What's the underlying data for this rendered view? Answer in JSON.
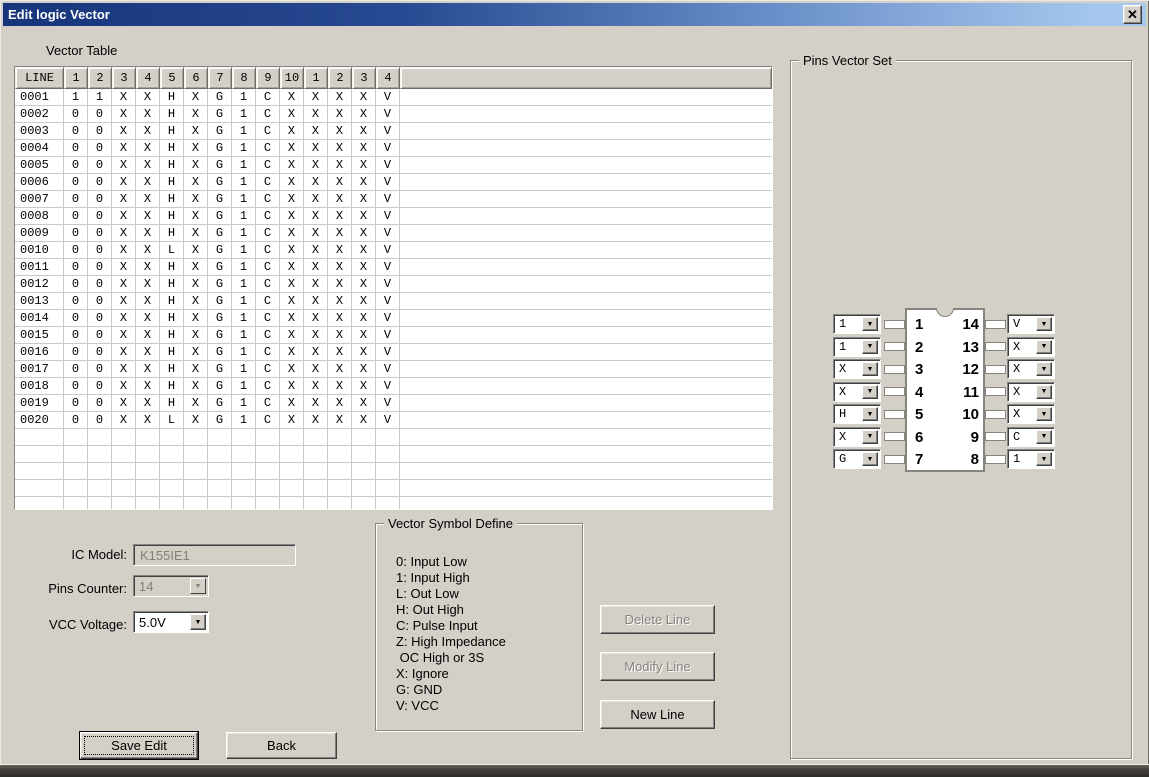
{
  "window": {
    "title": "Edit logic Vector"
  },
  "icons": {
    "close": "✕",
    "dropdown_arrow": "▼"
  },
  "colors": {
    "window_bg": "#d4d0c8",
    "titlebar_start": "#16357b",
    "titlebar_end": "#a6c8ee",
    "grid_line": "#c9c9c9",
    "disabled_text": "#828078"
  },
  "table": {
    "section_label": "Vector Table",
    "headers": [
      "LINE",
      "1",
      "2",
      "3",
      "4",
      "5",
      "6",
      "7",
      "8",
      "9",
      "10",
      "1",
      "2",
      "3",
      "4"
    ],
    "rows": [
      {
        "line": "0001",
        "values": [
          "1",
          "1",
          "X",
          "X",
          "H",
          "X",
          "G",
          "1",
          "C",
          "X",
          "X",
          "X",
          "X",
          "V"
        ]
      },
      {
        "line": "0002",
        "values": [
          "0",
          "0",
          "X",
          "X",
          "H",
          "X",
          "G",
          "1",
          "C",
          "X",
          "X",
          "X",
          "X",
          "V"
        ]
      },
      {
        "line": "0003",
        "values": [
          "0",
          "0",
          "X",
          "X",
          "H",
          "X",
          "G",
          "1",
          "C",
          "X",
          "X",
          "X",
          "X",
          "V"
        ]
      },
      {
        "line": "0004",
        "values": [
          "0",
          "0",
          "X",
          "X",
          "H",
          "X",
          "G",
          "1",
          "C",
          "X",
          "X",
          "X",
          "X",
          "V"
        ]
      },
      {
        "line": "0005",
        "values": [
          "0",
          "0",
          "X",
          "X",
          "H",
          "X",
          "G",
          "1",
          "C",
          "X",
          "X",
          "X",
          "X",
          "V"
        ]
      },
      {
        "line": "0006",
        "values": [
          "0",
          "0",
          "X",
          "X",
          "H",
          "X",
          "G",
          "1",
          "C",
          "X",
          "X",
          "X",
          "X",
          "V"
        ]
      },
      {
        "line": "0007",
        "values": [
          "0",
          "0",
          "X",
          "X",
          "H",
          "X",
          "G",
          "1",
          "C",
          "X",
          "X",
          "X",
          "X",
          "V"
        ]
      },
      {
        "line": "0008",
        "values": [
          "0",
          "0",
          "X",
          "X",
          "H",
          "X",
          "G",
          "1",
          "C",
          "X",
          "X",
          "X",
          "X",
          "V"
        ]
      },
      {
        "line": "0009",
        "values": [
          "0",
          "0",
          "X",
          "X",
          "H",
          "X",
          "G",
          "1",
          "C",
          "X",
          "X",
          "X",
          "X",
          "V"
        ]
      },
      {
        "line": "0010",
        "values": [
          "0",
          "0",
          "X",
          "X",
          "L",
          "X",
          "G",
          "1",
          "C",
          "X",
          "X",
          "X",
          "X",
          "V"
        ]
      },
      {
        "line": "0011",
        "values": [
          "0",
          "0",
          "X",
          "X",
          "H",
          "X",
          "G",
          "1",
          "C",
          "X",
          "X",
          "X",
          "X",
          "V"
        ]
      },
      {
        "line": "0012",
        "values": [
          "0",
          "0",
          "X",
          "X",
          "H",
          "X",
          "G",
          "1",
          "C",
          "X",
          "X",
          "X",
          "X",
          "V"
        ]
      },
      {
        "line": "0013",
        "values": [
          "0",
          "0",
          "X",
          "X",
          "H",
          "X",
          "G",
          "1",
          "C",
          "X",
          "X",
          "X",
          "X",
          "V"
        ]
      },
      {
        "line": "0014",
        "values": [
          "0",
          "0",
          "X",
          "X",
          "H",
          "X",
          "G",
          "1",
          "C",
          "X",
          "X",
          "X",
          "X",
          "V"
        ]
      },
      {
        "line": "0015",
        "values": [
          "0",
          "0",
          "X",
          "X",
          "H",
          "X",
          "G",
          "1",
          "C",
          "X",
          "X",
          "X",
          "X",
          "V"
        ]
      },
      {
        "line": "0016",
        "values": [
          "0",
          "0",
          "X",
          "X",
          "H",
          "X",
          "G",
          "1",
          "C",
          "X",
          "X",
          "X",
          "X",
          "V"
        ]
      },
      {
        "line": "0017",
        "values": [
          "0",
          "0",
          "X",
          "X",
          "H",
          "X",
          "G",
          "1",
          "C",
          "X",
          "X",
          "X",
          "X",
          "V"
        ]
      },
      {
        "line": "0018",
        "values": [
          "0",
          "0",
          "X",
          "X",
          "H",
          "X",
          "G",
          "1",
          "C",
          "X",
          "X",
          "X",
          "X",
          "V"
        ]
      },
      {
        "line": "0019",
        "values": [
          "0",
          "0",
          "X",
          "X",
          "H",
          "X",
          "G",
          "1",
          "C",
          "X",
          "X",
          "X",
          "X",
          "V"
        ]
      },
      {
        "line": "0020",
        "values": [
          "0",
          "0",
          "X",
          "X",
          "L",
          "X",
          "G",
          "1",
          "C",
          "X",
          "X",
          "X",
          "X",
          "V"
        ]
      }
    ],
    "empty_row_count": 5
  },
  "form": {
    "ic_model_label": "IC Model:",
    "ic_model_value": "K155IE1",
    "pins_counter_label": "Pins Counter:",
    "pins_counter_value": "14",
    "vcc_label": "VCC Voltage:",
    "vcc_value": "5.0V"
  },
  "symbol_define": {
    "title": "Vector Symbol Define",
    "items": [
      "0: Input Low",
      "1: Input High",
      "L: Out Low",
      "H: Out High",
      "C: Pulse Input",
      "Z: High Impedance",
      " OC High or 3S",
      "X: Ignore",
      "G: GND",
      "V: VCC"
    ]
  },
  "buttons": {
    "delete_line": "Delete Line",
    "modify_line": "Modify Line",
    "new_line": "New Line",
    "save_edit": "Save Edit",
    "back": "Back"
  },
  "pins_set": {
    "title": "Pins Vector Set",
    "left_pins": [
      {
        "pin": "1",
        "value": "1"
      },
      {
        "pin": "2",
        "value": "1"
      },
      {
        "pin": "3",
        "value": "X"
      },
      {
        "pin": "4",
        "value": "X"
      },
      {
        "pin": "5",
        "value": "H"
      },
      {
        "pin": "6",
        "value": "X"
      },
      {
        "pin": "7",
        "value": "G"
      }
    ],
    "right_pins": [
      {
        "pin": "14",
        "value": "V"
      },
      {
        "pin": "13",
        "value": "X"
      },
      {
        "pin": "12",
        "value": "X"
      },
      {
        "pin": "11",
        "value": "X"
      },
      {
        "pin": "10",
        "value": "X"
      },
      {
        "pin": "9",
        "value": "C"
      },
      {
        "pin": "8",
        "value": "1"
      }
    ]
  }
}
